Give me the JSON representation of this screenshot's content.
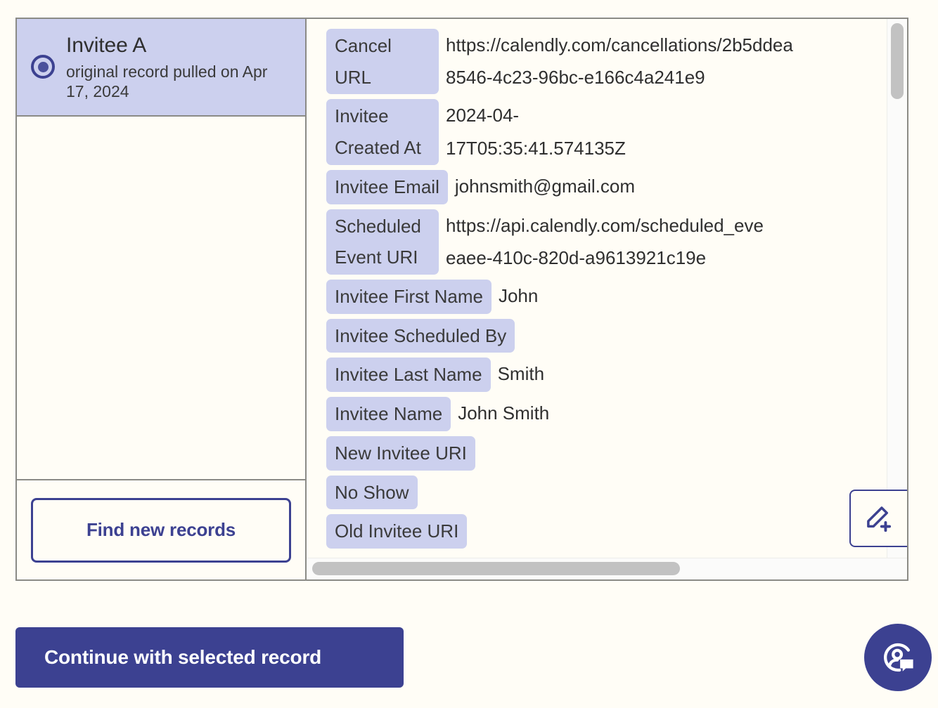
{
  "colors": {
    "accent": "#3c4191",
    "chip_bg": "#ccd0ee",
    "page_bg": "#fffdf6",
    "border": "#8b8b86",
    "scroll_thumb": "#c2c2c2"
  },
  "record_list": {
    "options": [
      {
        "title": "Invitee A",
        "subtitle": "original record pulled on Apr 17, 2024",
        "selected": true
      }
    ],
    "find_new_records_label": "Find new records"
  },
  "record_detail": {
    "fields": [
      {
        "label": "Cancel URL",
        "label_wraps": true,
        "value_lines": [
          "https://calendly.com/cancellations/2b5ddea",
          "8546-4c23-96bc-e166c4a241e9"
        ]
      },
      {
        "label": "Invitee Created At",
        "label_wraps": true,
        "value_lines": [
          "2024-04-",
          "17T05:35:41.574135Z"
        ]
      },
      {
        "label": "Invitee Email",
        "label_wraps": false,
        "value_lines": [
          "johnsmith@gmail.com"
        ]
      },
      {
        "label": "Scheduled Event URI",
        "label_wraps": true,
        "value_lines": [
          "https://api.calendly.com/scheduled_eve",
          "eaee-410c-820d-a9613921c19e"
        ]
      },
      {
        "label": "Invitee First Name",
        "label_wraps": false,
        "value_lines": [
          "John"
        ]
      },
      {
        "label": "Invitee Scheduled By",
        "label_wraps": false,
        "value_lines": []
      },
      {
        "label": "Invitee Last Name",
        "label_wraps": false,
        "value_lines": [
          "Smith"
        ]
      },
      {
        "label": "Invitee Name",
        "label_wraps": false,
        "value_lines": [
          "John Smith"
        ]
      },
      {
        "label": "New Invitee URI",
        "label_wraps": false,
        "value_lines": []
      },
      {
        "label": "No Show",
        "label_wraps": false,
        "value_lines": []
      },
      {
        "label": "Old Invitee URI",
        "label_wraps": false,
        "value_lines": []
      }
    ],
    "edit_icon": "pencil-plus-icon"
  },
  "footer": {
    "continue_label": "Continue with selected record"
  },
  "support": {
    "icon": "support-agent-chat-icon"
  }
}
